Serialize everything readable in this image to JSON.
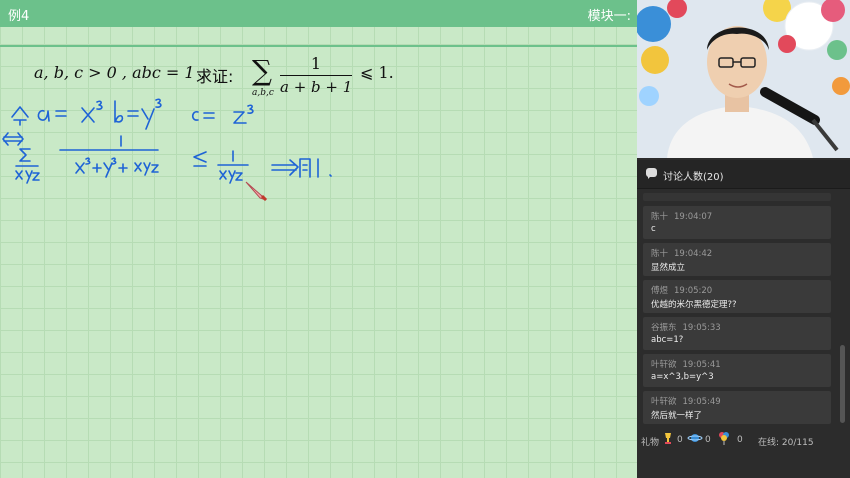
{
  "board": {
    "title": "例4",
    "module_label": "模块一:",
    "problem": {
      "condition": "a, b, c > 0 , abc = 1 ,",
      "claim_prefix": "求证:",
      "sum_symbol": "∑",
      "sum_index": "a,b,c",
      "numerator": "1",
      "denominator": "a + b + 1",
      "relation": "⩽ 1."
    },
    "colors": {
      "header": "#6cc18b",
      "board_bg": "#c9e9c7",
      "ink": "#1e63d6"
    }
  },
  "sidebar": {
    "chat_header_label": "讨论人数(20)",
    "messages": [
      {
        "user": "陈十",
        "time": "19:04:07",
        "text": "c"
      },
      {
        "user": "陈十",
        "time": "19:04:42",
        "text": "显然成立"
      },
      {
        "user": "傅煜",
        "time": "19:05:20",
        "text": "优越的米尔黑德定理??"
      },
      {
        "user": "谷振东",
        "time": "19:05:33",
        "text": "abc=1?"
      },
      {
        "user": "叶轩欲",
        "time": "19:05:41",
        "text": "a=x^3,b=y^3"
      },
      {
        "user": "叶轩欲",
        "time": "19:05:49",
        "text": "然后就一样了"
      }
    ],
    "footer": {
      "gift_label": "礼物",
      "gift_counts": [
        "0",
        "0",
        "0"
      ],
      "online_label": "在线:",
      "online_value": "20/115"
    }
  }
}
